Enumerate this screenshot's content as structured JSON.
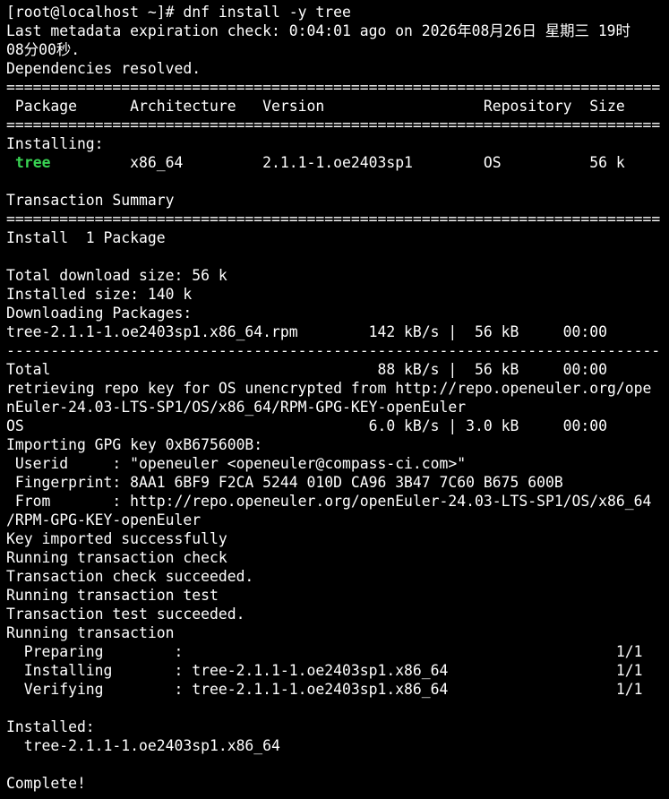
{
  "terminal": {
    "pkg_name": "tree",
    "lines": [
      "[root@localhost ~]# dnf install -y tree",
      "Last metadata expiration check: 0:04:01 ago on 2026年08月26日 星期三 19时",
      "08分00秒.",
      "Dependencies resolved.",
      "==========================================================================",
      " Package      Architecture   Version                  Repository  Size",
      "==========================================================================",
      "Installing:",
      "              x86_64         2.1.1-1.oe2403sp1        OS          56 k",
      "",
      "Transaction Summary",
      "==========================================================================",
      "Install  1 Package",
      "",
      "Total download size: 56 k",
      "Installed size: 140 k",
      "Downloading Packages:",
      "tree-2.1.1-1.oe2403sp1.x86_64.rpm        142 kB/s |  56 kB     00:00",
      "--------------------------------------------------------------------------",
      "Total                                     88 kB/s |  56 kB     00:00",
      "retrieving repo key for OS unencrypted from http://repo.openeuler.org/ope",
      "nEuler-24.03-LTS-SP1/OS/x86_64/RPM-GPG-KEY-openEuler",
      "OS                                       6.0 kB/s | 3.0 kB     00:00",
      "Importing GPG key 0xB675600B:",
      " Userid     : \"openeuler <openeuler@compass-ci.com>\"",
      " Fingerprint: 8AA1 6BF9 F2CA 5244 010D CA96 3B47 7C60 B675 600B",
      " From       : http://repo.openeuler.org/openEuler-24.03-LTS-SP1/OS/x86_64",
      "/RPM-GPG-KEY-openEuler",
      "Key imported successfully",
      "Running transaction check",
      "Transaction check succeeded.",
      "Running transaction test",
      "Transaction test succeeded.",
      "Running transaction",
      "  Preparing        :                                                 1/1",
      "  Installing       : tree-2.1.1-1.oe2403sp1.x86_64                   1/1",
      "  Verifying        : tree-2.1.1-1.oe2403sp1.x86_64                   1/1",
      "",
      "Installed:",
      "  tree-2.1.1-1.oe2403sp1.x86_64",
      "",
      "Complete!"
    ]
  },
  "colors": {
    "background": "#000000",
    "foreground": "#ffffff",
    "highlight": "#39d353"
  }
}
